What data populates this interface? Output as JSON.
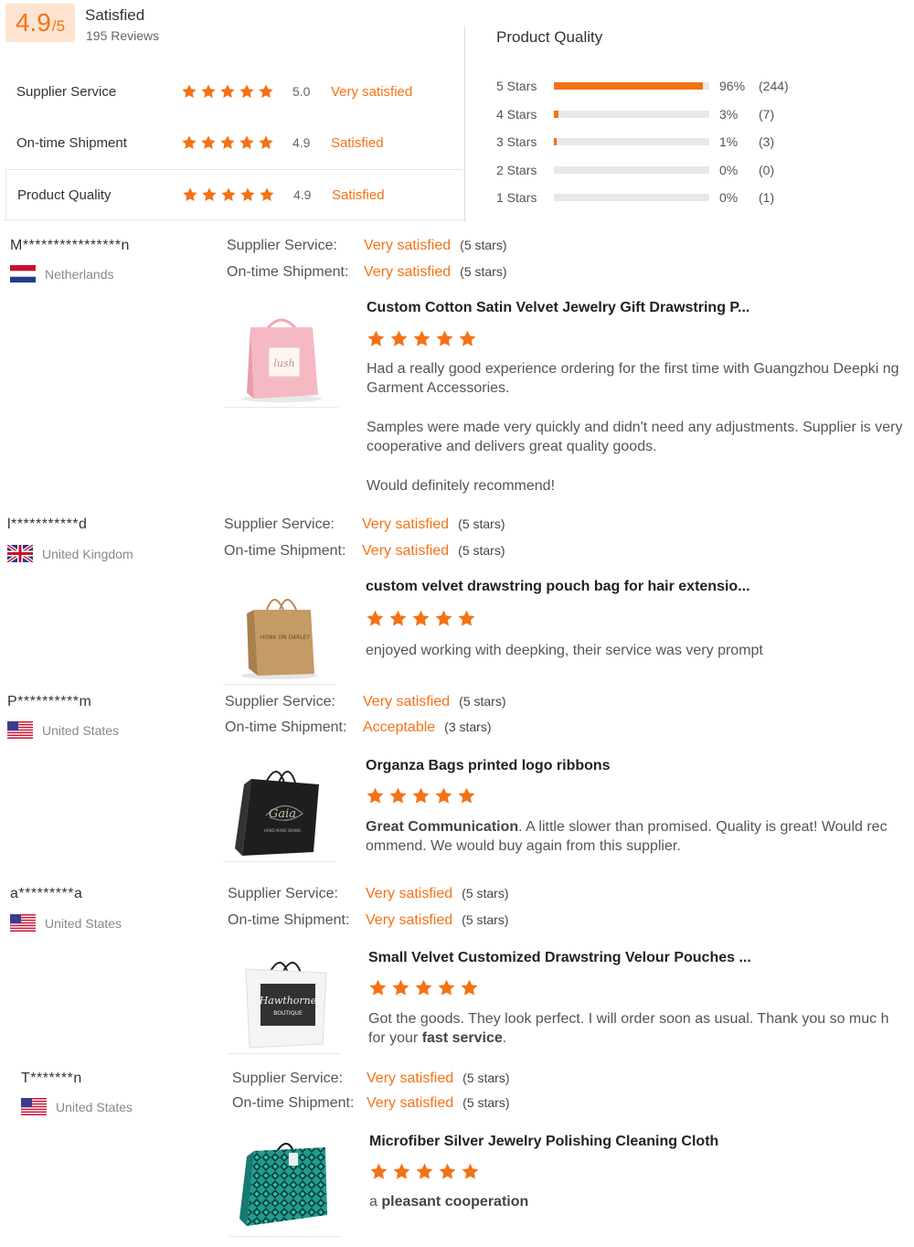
{
  "summary": {
    "score": "4.9",
    "score_max": "/5",
    "status": "Satisfied",
    "reviews": "195 Reviews",
    "metrics": [
      {
        "label": "Supplier Service",
        "score": "5.0",
        "text": "Very satisfied"
      },
      {
        "label": "On-time Shipment",
        "score": "4.9",
        "text": "Satisfied"
      },
      {
        "label": "Product Quality",
        "score": "4.9",
        "text": "Satisfied"
      }
    ]
  },
  "quality": {
    "title": "Product Quality",
    "rows": [
      {
        "label": "5 Stars",
        "pct": "96%",
        "count": "(244)",
        "fill": 0.96
      },
      {
        "label": "4 Stars",
        "pct": "3%",
        "count": "(7)",
        "fill": 0.03
      },
      {
        "label": "3 Stars",
        "pct": "1%",
        "count": "(3)",
        "fill": 0.01
      },
      {
        "label": "2 Stars",
        "pct": "0%",
        "count": "(0)",
        "fill": 0
      },
      {
        "label": "1 Stars",
        "pct": "0%",
        "count": "(1)",
        "fill": 0
      }
    ]
  },
  "colors": {
    "accent": "#f47216",
    "track": "#e8e8e8"
  },
  "labels": {
    "supplier_service": "Supplier Service:",
    "ontime_shipment": "On-time Shipment:"
  },
  "reviews": [
    {
      "name": "M****************n",
      "country": "Netherlands",
      "flag": "netherlands-flag-icon",
      "service": "Very satisfied",
      "service_stars": "(5 stars)",
      "shipment": "Very satisfied",
      "shipment_stars": "(5 stars)",
      "product": "Custom Cotton Satin Velvet Jewelry Gift Drawstring P...",
      "rating": 5,
      "comment_1": "Had a really good experience ordering for the first time with Guangzhou Deepki ng Garment Accessories.",
      "comment_2": "Samples were made very quickly and didn't need any adjustments. Supplier is very cooperative and delivers great quality goods.",
      "comment_3": "Would definitely recommend!"
    },
    {
      "name": "l***********d",
      "country": "United Kingdom",
      "flag": "uk-flag-icon",
      "service": "Very satisfied",
      "service_stars": "(5 stars)",
      "shipment": "Very satisfied",
      "shipment_stars": "(5 stars)",
      "product": "custom velvet drawstring pouch bag for hair extensio...",
      "rating": 5,
      "comment_1": "enjoyed working with deepking, their service was very prompt"
    },
    {
      "name": "P**********m",
      "country": "United States",
      "flag": "us-flag-icon",
      "service": "Very satisfied",
      "service_stars": "(5 stars)",
      "shipment": "Acceptable",
      "shipment_stars": "(3 stars)",
      "product": "Organza Bags printed logo ribbons",
      "rating": 5,
      "comment_bold": "Great Communication",
      "comment_1": ". A little slower than promised. Quality is great! Would rec ommend. We would buy again from this supplier."
    },
    {
      "name": "a*********a",
      "country": "United States",
      "flag": "us-flag-icon",
      "service": "Very satisfied",
      "service_stars": "(5 stars)",
      "shipment": "Very satisfied",
      "shipment_stars": "(5 stars)",
      "product": "Small Velvet Customized Drawstring Velour Pouches ...",
      "rating": 5,
      "comment_1": "Got the goods. They look perfect. I will order soon as usual. Thank you so muc h for your ",
      "comment_bold": "fast service",
      "comment_2": "."
    },
    {
      "name": "T*******n",
      "country": "United States",
      "flag": "us-flag-icon",
      "service": "Very satisfied",
      "service_stars": "(5 stars)",
      "shipment": "Very satisfied",
      "shipment_stars": "(5 stars)",
      "product": "Microfiber Silver Jewelry Polishing Cleaning Cloth",
      "rating": 5,
      "comment_1": "a ",
      "comment_bold": "pleasant cooperation"
    }
  ]
}
